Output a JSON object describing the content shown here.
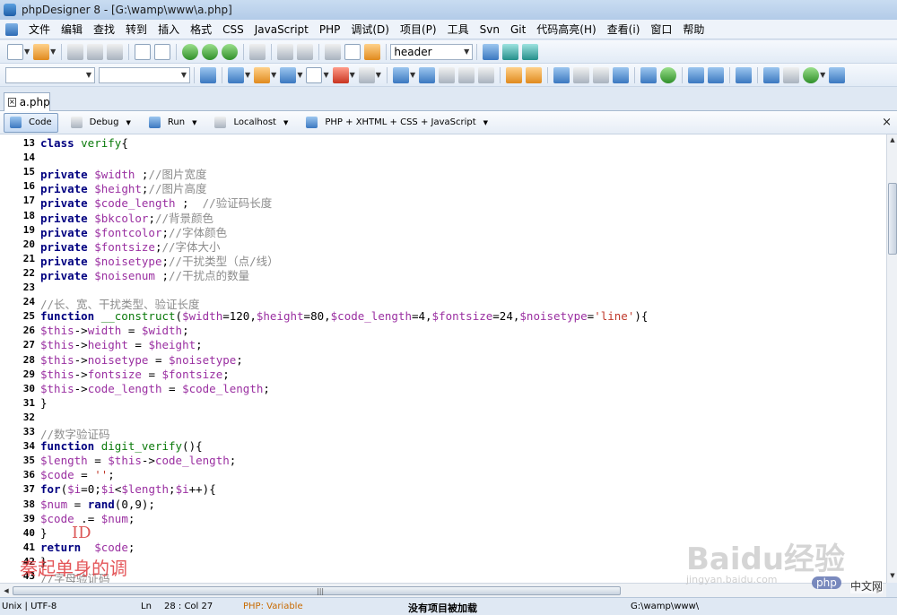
{
  "window": {
    "title": "phpDesigner 8 - [G:\\wamp\\www\\a.php]"
  },
  "menu": [
    "文件",
    "编辑",
    "查找",
    "转到",
    "插入",
    "格式",
    "CSS",
    "JavaScript",
    "PHP",
    "调试(D)",
    "项目(P)",
    "工具",
    "Svn",
    "Git",
    "代码高亮(H)",
    "查看(i)",
    "窗口",
    "帮助"
  ],
  "toolbar": {
    "search_combo_value": "header",
    "combo1_value": "",
    "combo2_value": ""
  },
  "tabs": [
    {
      "label": "a.php"
    }
  ],
  "modebar": {
    "code": "Code",
    "debug": "Debug",
    "run": "Run",
    "localhost": "Localhost",
    "doc_type": "PHP + XHTML + CSS + JavaScript",
    "close": "×"
  },
  "code_lines": [
    {
      "n": "13",
      "tokens": [
        [
          "kw",
          "class "
        ],
        [
          "fn",
          "verify"
        ],
        [
          "plain",
          "{"
        ]
      ]
    },
    {
      "n": "14",
      "tokens": []
    },
    {
      "n": "15",
      "tokens": [
        [
          "kw",
          "private "
        ],
        [
          "var",
          "$width"
        ],
        [
          "plain",
          " ;"
        ],
        [
          "cmt",
          "//图片宽度"
        ]
      ]
    },
    {
      "n": "16",
      "tokens": [
        [
          "kw",
          "private "
        ],
        [
          "var",
          "$height"
        ],
        [
          "plain",
          ";"
        ],
        [
          "cmt",
          "//图片高度"
        ]
      ]
    },
    {
      "n": "17",
      "tokens": [
        [
          "kw",
          "private "
        ],
        [
          "var",
          "$code_length"
        ],
        [
          "plain",
          " ;  "
        ],
        [
          "cmt",
          "//验证码长度"
        ]
      ]
    },
    {
      "n": "18",
      "tokens": [
        [
          "kw",
          "private "
        ],
        [
          "var",
          "$bkcolor"
        ],
        [
          "plain",
          ";"
        ],
        [
          "cmt",
          "//背景颜色"
        ]
      ]
    },
    {
      "n": "19",
      "tokens": [
        [
          "kw",
          "private "
        ],
        [
          "var",
          "$fontcolor"
        ],
        [
          "plain",
          ";"
        ],
        [
          "cmt",
          "//字体颜色"
        ]
      ]
    },
    {
      "n": "20",
      "tokens": [
        [
          "kw",
          "private "
        ],
        [
          "var",
          "$fontsize"
        ],
        [
          "plain",
          ";"
        ],
        [
          "cmt",
          "//字体大小"
        ]
      ]
    },
    {
      "n": "21",
      "tokens": [
        [
          "kw",
          "private "
        ],
        [
          "var",
          "$noisetype"
        ],
        [
          "plain",
          ";"
        ],
        [
          "cmt",
          "//干扰类型（点/线）"
        ]
      ]
    },
    {
      "n": "22",
      "tokens": [
        [
          "kw",
          "private "
        ],
        [
          "var",
          "$noisenum"
        ],
        [
          "plain",
          " ;"
        ],
        [
          "cmt",
          "//干扰点的数量"
        ]
      ]
    },
    {
      "n": "23",
      "tokens": []
    },
    {
      "n": "24",
      "tokens": [
        [
          "cmt",
          "//长、宽、干扰类型、验证长度"
        ]
      ]
    },
    {
      "n": "25",
      "tokens": [
        [
          "kw",
          "function "
        ],
        [
          "fn",
          "__construct"
        ],
        [
          "plain",
          "("
        ],
        [
          "var",
          "$width"
        ],
        [
          "plain",
          "=120,"
        ],
        [
          "var",
          "$height"
        ],
        [
          "plain",
          "=80,"
        ],
        [
          "var",
          "$code_length"
        ],
        [
          "plain",
          "=4,"
        ],
        [
          "var",
          "$fontsize"
        ],
        [
          "plain",
          "=24,"
        ],
        [
          "var",
          "$noisetype"
        ],
        [
          "plain",
          "="
        ],
        [
          "str",
          "'line'"
        ],
        [
          "plain",
          "){"
        ]
      ]
    },
    {
      "n": "26",
      "tokens": [
        [
          "var",
          "$this"
        ],
        [
          "plain",
          "->"
        ],
        [
          "prop",
          "width"
        ],
        [
          "plain",
          " = "
        ],
        [
          "var",
          "$width"
        ],
        [
          "plain",
          ";"
        ]
      ]
    },
    {
      "n": "27",
      "tokens": [
        [
          "var",
          "$this"
        ],
        [
          "plain",
          "->"
        ],
        [
          "prop",
          "height"
        ],
        [
          "plain",
          " = "
        ],
        [
          "var",
          "$height"
        ],
        [
          "plain",
          ";"
        ]
      ]
    },
    {
      "n": "28",
      "tokens": [
        [
          "var",
          "$this"
        ],
        [
          "plain",
          "->"
        ],
        [
          "prop",
          "noisetype"
        ],
        [
          "plain",
          " = "
        ],
        [
          "var",
          "$noisetype"
        ],
        [
          "plain",
          ";"
        ]
      ]
    },
    {
      "n": "29",
      "tokens": [
        [
          "var",
          "$this"
        ],
        [
          "plain",
          "->"
        ],
        [
          "prop",
          "fontsize"
        ],
        [
          "plain",
          " = "
        ],
        [
          "var",
          "$fontsize"
        ],
        [
          "plain",
          ";"
        ]
      ]
    },
    {
      "n": "30",
      "tokens": [
        [
          "var",
          "$this"
        ],
        [
          "plain",
          "->"
        ],
        [
          "prop",
          "code_length"
        ],
        [
          "plain",
          " = "
        ],
        [
          "var",
          "$code_length"
        ],
        [
          "plain",
          ";"
        ]
      ]
    },
    {
      "n": "31",
      "tokens": [
        [
          "plain",
          "}"
        ]
      ]
    },
    {
      "n": "32",
      "tokens": []
    },
    {
      "n": "33",
      "tokens": [
        [
          "cmt",
          "//数字验证码"
        ]
      ]
    },
    {
      "n": "34",
      "tokens": [
        [
          "kw",
          "function "
        ],
        [
          "fn",
          "digit_verify"
        ],
        [
          "plain",
          "(){"
        ]
      ]
    },
    {
      "n": "35",
      "tokens": [
        [
          "var",
          "$length"
        ],
        [
          "plain",
          " = "
        ],
        [
          "var",
          "$this"
        ],
        [
          "plain",
          "->"
        ],
        [
          "prop",
          "code_length"
        ],
        [
          "plain",
          ";"
        ]
      ]
    },
    {
      "n": "36",
      "tokens": [
        [
          "var",
          "$code"
        ],
        [
          "plain",
          " = "
        ],
        [
          "str",
          "''"
        ],
        [
          "plain",
          ";"
        ]
      ]
    },
    {
      "n": "37",
      "tokens": [
        [
          "kw",
          "for"
        ],
        [
          "plain",
          "("
        ],
        [
          "var",
          "$i"
        ],
        [
          "plain",
          "=0;"
        ],
        [
          "var",
          "$i"
        ],
        [
          "plain",
          "<"
        ],
        [
          "var",
          "$length"
        ],
        [
          "plain",
          ";"
        ],
        [
          "var",
          "$i"
        ],
        [
          "plain",
          "++){"
        ]
      ]
    },
    {
      "n": "38",
      "tokens": [
        [
          "var",
          "$num"
        ],
        [
          "plain",
          " = "
        ],
        [
          "kw",
          "rand"
        ],
        [
          "plain",
          "(0,9);"
        ]
      ]
    },
    {
      "n": "39",
      "tokens": [
        [
          "var",
          "$code"
        ],
        [
          "plain",
          " .= "
        ],
        [
          "var",
          "$num"
        ],
        [
          "plain",
          ";"
        ]
      ]
    },
    {
      "n": "40",
      "tokens": [
        [
          "plain",
          "}"
        ]
      ]
    },
    {
      "n": "41",
      "tokens": [
        [
          "kw",
          "return "
        ],
        [
          "plain",
          " "
        ],
        [
          "var",
          "$code"
        ],
        [
          "plain",
          ";"
        ]
      ]
    },
    {
      "n": "42",
      "tokens": [
        [
          "plain",
          "}"
        ]
      ]
    },
    {
      "n": "43",
      "tokens": [
        [
          "cmt",
          "//字母验证码"
        ]
      ]
    }
  ],
  "status": {
    "eol_encoding": "Unix | UTF-8",
    "ln_label": "Ln",
    "position": "28 : Col  27",
    "context": "PHP: Variable",
    "project": "没有项目被加载",
    "path": "G:\\wamp\\www\\"
  },
  "overlays": {
    "annotation_id": "ID",
    "annotation_text": "秦起单身的调",
    "watermark": "Baidu经验",
    "watermark_sub": "jingyan.baidu.com",
    "badge": "php",
    "badge_text": "中文网"
  }
}
